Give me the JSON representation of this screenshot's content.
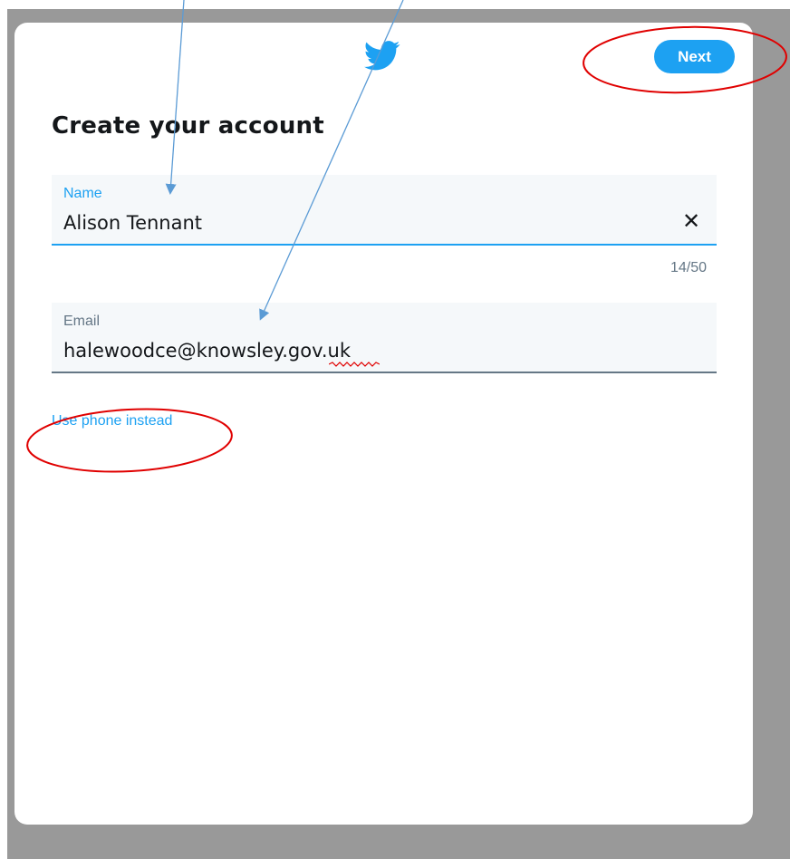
{
  "signup": {
    "title": "Create your account",
    "next_label": "Next",
    "name": {
      "label": "Name",
      "value": "Alison Tennant",
      "counter": "14/50",
      "clear_glyph": "✕"
    },
    "email": {
      "label": "Email",
      "value": "halewoodce@knowsley.gov.uk"
    },
    "use_phone_label": "Use phone instead"
  },
  "icons": {
    "logo": "twitter-bird-icon",
    "clear": "close-icon"
  },
  "colors": {
    "accent": "#1da1f2",
    "backdrop": "#999999",
    "text": "#14171a",
    "muted": "#657786",
    "field_background": "#f5f8fa",
    "annotation_arrow": "#5b9bd5",
    "annotation_circle": "#e00000"
  }
}
